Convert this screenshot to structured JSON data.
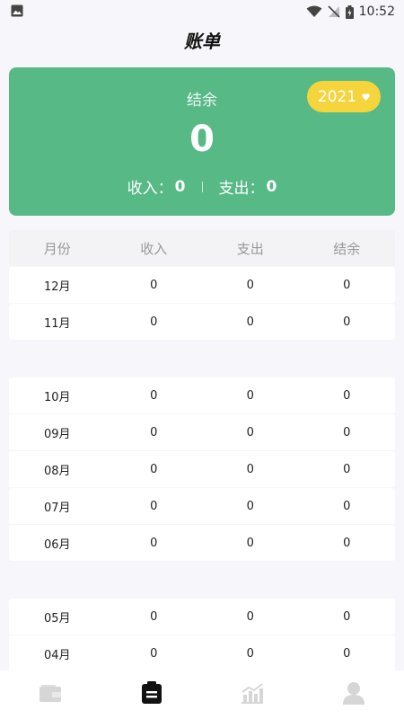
{
  "status_bar": {
    "time": "10:52"
  },
  "header": {
    "title": "账单"
  },
  "summary": {
    "balance_label": "结余",
    "balance_value": "0",
    "year": "2021",
    "income_label": "收入：",
    "income_value": "0",
    "expense_label": "支出：",
    "expense_value": "0"
  },
  "table": {
    "headers": [
      "月份",
      "收入",
      "支出",
      "结余"
    ],
    "rows": [
      {
        "month": "12月",
        "income": "0",
        "expense": "0",
        "balance": "0"
      },
      {
        "month": "11月",
        "income": "0",
        "expense": "0",
        "balance": "0"
      },
      {
        "month": "10月",
        "income": "0",
        "expense": "0",
        "balance": "0"
      },
      {
        "month": "09月",
        "income": "0",
        "expense": "0",
        "balance": "0"
      },
      {
        "month": "08月",
        "income": "0",
        "expense": "0",
        "balance": "0"
      },
      {
        "month": "07月",
        "income": "0",
        "expense": "0",
        "balance": "0"
      },
      {
        "month": "06月",
        "income": "0",
        "expense": "0",
        "balance": "0"
      },
      {
        "month": "05月",
        "income": "0",
        "expense": "0",
        "balance": "0"
      },
      {
        "month": "04月",
        "income": "0",
        "expense": "0",
        "balance": "0"
      }
    ]
  },
  "nav": [
    {
      "icon": "wallet-icon",
      "active": false
    },
    {
      "icon": "bill-icon",
      "active": true
    },
    {
      "icon": "chart-icon",
      "active": false
    },
    {
      "icon": "profile-icon",
      "active": false
    }
  ],
  "colors": {
    "card": "#56b986",
    "year_pill": "#f6d43b",
    "page_bg": "#f6f6fb",
    "nav_active": "#111111",
    "nav_inactive": "#d6d6d6"
  }
}
